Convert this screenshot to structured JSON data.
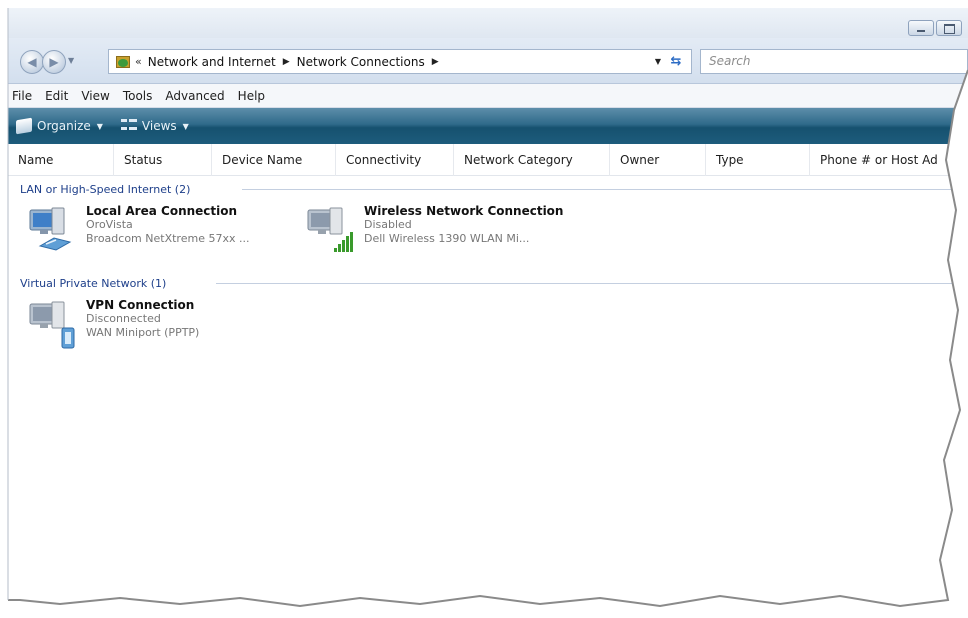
{
  "window": {
    "caption_buttons": [
      "minimize",
      "maximize"
    ]
  },
  "navigation": {
    "breadcrumbs": [
      "Network and Internet",
      "Network Connections"
    ],
    "overflow_glyph": "«",
    "search_placeholder": "Search"
  },
  "menu": [
    "File",
    "Edit",
    "View",
    "Tools",
    "Advanced",
    "Help"
  ],
  "commands": {
    "organize": "Organize",
    "views": "Views"
  },
  "columns": [
    "Name",
    "Status",
    "Device Name",
    "Connectivity",
    "Network Category",
    "Owner",
    "Type",
    "Phone # or Host Ad"
  ],
  "groups": [
    {
      "header": "LAN or High-Speed Internet (2)",
      "items": [
        {
          "name": "Local Area Connection",
          "status": "OroVista",
          "device": "Broadcom NetXtreme 57xx ...",
          "icon": "wired-network-connection-icon"
        },
        {
          "name": "Wireless Network Connection",
          "status": "Disabled",
          "device": "Dell Wireless 1390 WLAN Mi...",
          "icon": "wireless-network-connection-icon"
        }
      ]
    },
    {
      "header": "Virtual Private Network (1)",
      "items": [
        {
          "name": "VPN Connection",
          "status": "Disconnected",
          "device": "WAN Miniport (PPTP)",
          "icon": "vpn-connection-icon"
        }
      ]
    }
  ],
  "colors": {
    "accent_blue": "#1e3f8a",
    "command_bar": "#1d5c7c",
    "signal_green": "#3a9a2c"
  }
}
